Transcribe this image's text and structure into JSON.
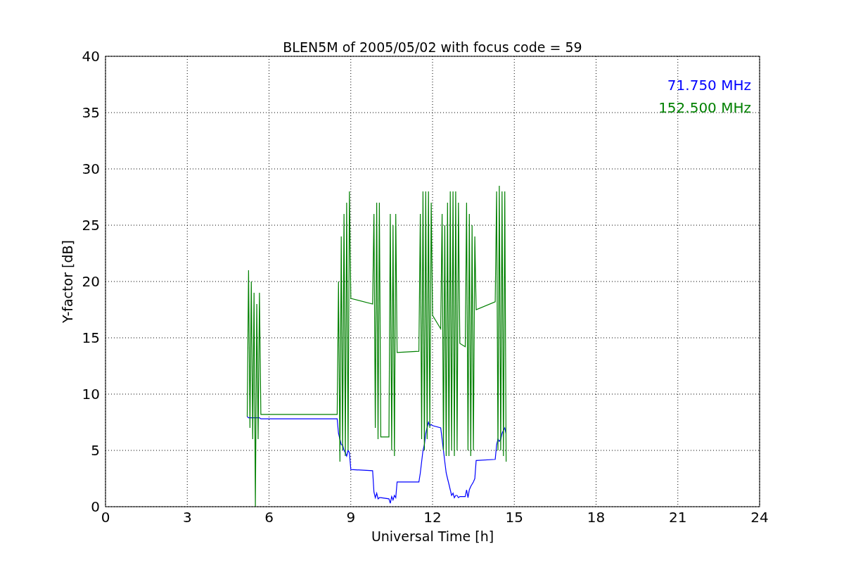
{
  "chart_data": {
    "type": "line",
    "title": "BLEN5M of 2005/05/02 with focus code = 59",
    "xlabel": "Universal Time [h]",
    "ylabel": "Y-factor [dB]",
    "xlim": [
      0,
      24
    ],
    "ylim": [
      0,
      40
    ],
    "xticks": [
      0,
      3,
      6,
      9,
      12,
      15,
      18,
      21,
      24
    ],
    "yticks": [
      0,
      5,
      10,
      15,
      20,
      25,
      30,
      35,
      40
    ],
    "grid": true,
    "x": [
      5.2,
      5.25,
      5.3,
      5.35,
      5.4,
      5.45,
      5.5,
      5.55,
      5.6,
      5.65,
      5.7,
      8.5,
      8.55,
      8.6,
      8.65,
      8.7,
      8.75,
      8.8,
      8.85,
      8.9,
      8.95,
      9.0,
      9.8,
      9.85,
      9.9,
      9.95,
      10.0,
      10.05,
      10.1,
      10.4,
      10.45,
      10.5,
      10.55,
      10.6,
      10.65,
      10.7,
      11.5,
      11.55,
      11.6,
      11.65,
      11.7,
      11.75,
      11.8,
      11.85,
      11.9,
      11.95,
      12.0,
      12.3,
      12.35,
      12.4,
      12.45,
      12.5,
      12.55,
      12.6,
      12.65,
      12.7,
      12.75,
      12.8,
      12.85,
      12.9,
      12.95,
      13.0,
      13.2,
      13.25,
      13.3,
      13.35,
      13.4,
      13.45,
      13.5,
      13.55,
      13.6,
      14.3,
      14.35,
      14.4,
      14.45,
      14.5,
      14.55,
      14.6,
      14.65,
      14.7
    ],
    "series": [
      {
        "name": "71.750 MHz",
        "color": "#0000ff",
        "values": [
          8,
          7.9,
          7.9,
          7.9,
          7.9,
          7.9,
          7.9,
          7.9,
          7.9,
          7.9,
          7.8,
          7.8,
          6.5,
          6,
          5.5,
          5.5,
          5,
          4.8,
          4.5,
          5,
          4.8,
          3.3,
          3.2,
          1.3,
          0.8,
          1.2,
          0.7,
          0.8,
          0.8,
          0.7,
          0.3,
          0.9,
          0.6,
          1,
          0.8,
          2.2,
          2.2,
          3,
          4,
          5,
          5.5,
          6.5,
          7,
          7.5,
          7.2,
          7.3,
          7.2,
          7,
          6,
          5,
          4,
          3,
          2.5,
          2,
          1.5,
          1,
          1.2,
          0.8,
          1,
          1,
          0.8,
          0.9,
          0.9,
          1.5,
          0.8,
          1.5,
          1.8,
          2,
          2.2,
          2.5,
          4.1,
          4.2,
          5.5,
          6,
          5.8,
          6,
          6.5,
          6.8,
          7,
          6.5
        ]
      },
      {
        "name": "152.500 MHz",
        "color": "#008000",
        "values": [
          8,
          21,
          7,
          20,
          6,
          19,
          0,
          18,
          6,
          19,
          8.2,
          8.2,
          20,
          4,
          24,
          5,
          26,
          4.5,
          27,
          5,
          28,
          18.5,
          18,
          26,
          7,
          27,
          6,
          27,
          6.2,
          6.2,
          26,
          5,
          25,
          4.5,
          26,
          13.7,
          13.8,
          26,
          6,
          28,
          5,
          28,
          6,
          28,
          7,
          27,
          17,
          15.8,
          26,
          5,
          25,
          4.5,
          27,
          4.5,
          28,
          5,
          28,
          4.5,
          28,
          5,
          27,
          14.5,
          14.2,
          27,
          5,
          26,
          4.5,
          25,
          5,
          24,
          17.5,
          18.2,
          28,
          5,
          28.5,
          5,
          28,
          4.5,
          28,
          4
        ]
      }
    ]
  }
}
